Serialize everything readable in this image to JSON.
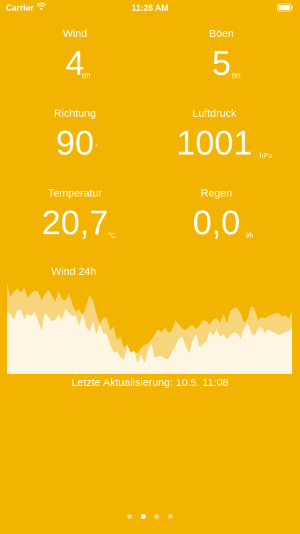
{
  "status_bar": {
    "carrier": "Carrier",
    "time": "11:28 AM"
  },
  "metrics": {
    "wind": {
      "label": "Wind",
      "value": "4",
      "unit": "Bft"
    },
    "gusts": {
      "label": "Böen",
      "value": "5",
      "unit": "Bft"
    },
    "direction": {
      "label": "Richtung",
      "value": "90",
      "unit": "°"
    },
    "pressure": {
      "label": "Luftdruck",
      "value": "1001",
      "unit": "hPa"
    },
    "temperature": {
      "label": "Temperatur",
      "value": "20,7",
      "unit": "°C"
    },
    "rain": {
      "label": "Regen",
      "value": "0,0",
      "unit": "l/h"
    }
  },
  "chart": {
    "title": "Wind 24h",
    "colors": {
      "gust_fill": "#F7D57C",
      "wind_fill": "#FDF6E3",
      "background": "#F2B400"
    }
  },
  "chart_data": {
    "type": "area",
    "title": "Wind 24h",
    "xlabel": "",
    "ylabel": "",
    "ylim": [
      0,
      10
    ],
    "grid": false,
    "series": [
      {
        "values": [
          9.7,
          8.3,
          8.9,
          9.2,
          8.8,
          9.3,
          8.2,
          8.7,
          9.0,
          8.9,
          8.0,
          8.6,
          9.1,
          8.5,
          7.8,
          8.9,
          8.1,
          7.9,
          8.7,
          7.5,
          6.7,
          7.0,
          6.3,
          7.3,
          8.5,
          7.9,
          6.5,
          5.4,
          6.0,
          6.1,
          4.7,
          5.1,
          3.6,
          4.0,
          2.8,
          3.2,
          1.9,
          2.4,
          2.2,
          2.8,
          3.1,
          3.3,
          3.7,
          4.3,
          4.8,
          4.5,
          5.0,
          4.4,
          4.7,
          5.8,
          5.3,
          4.9,
          4.7,
          5.1,
          5.3,
          4.8,
          5.2,
          5.8,
          5.7,
          5.3,
          5.9,
          6.0,
          5.5,
          6.5,
          5.4,
          6.8,
          7.1,
          7.1,
          6.5,
          5.5,
          5.9,
          7.3,
          7.1,
          5.8,
          6.1,
          6.0,
          6.2,
          6.4,
          6.5,
          6.6,
          6.2,
          6.3,
          6.0,
          6.8
        ]
      },
      {
        "values": [
          6.6,
          6.5,
          5.8,
          6.9,
          6.9,
          5.9,
          6.5,
          6.2,
          6.7,
          5.8,
          4.7,
          6.6,
          6.2,
          5.7,
          5.8,
          6.4,
          5.8,
          7.0,
          6.6,
          6.2,
          6.3,
          5.2,
          6.5,
          5.1,
          4.6,
          5.7,
          4.3,
          5.4,
          4.4,
          4.3,
          3.1,
          2.3,
          2.4,
          1.8,
          1.5,
          3.1,
          2.3,
          2.5,
          1.2,
          2.1,
          1.1,
          2.6,
          3.3,
          1.7,
          1.9,
          1.9,
          1.6,
          1.6,
          2.4,
          3.0,
          3.8,
          4.0,
          3.0,
          2.2,
          3.6,
          4.3,
          2.9,
          3.2,
          3.5,
          4.6,
          4.1,
          4.8,
          4.0,
          4.3,
          3.7,
          4.2,
          4.5,
          4.4,
          3.8,
          4.9,
          5.5,
          4.5,
          4.1,
          4.8,
          5.1,
          4.4,
          4.8,
          4.6,
          4.4,
          4.2,
          4.3,
          4.5,
          4.6,
          5.0
        ]
      }
    ]
  },
  "footer": {
    "last_update": "Letzte Aktualisierung: 10.5. 11:08"
  },
  "pager": {
    "pages": 4,
    "active_index": 1
  }
}
